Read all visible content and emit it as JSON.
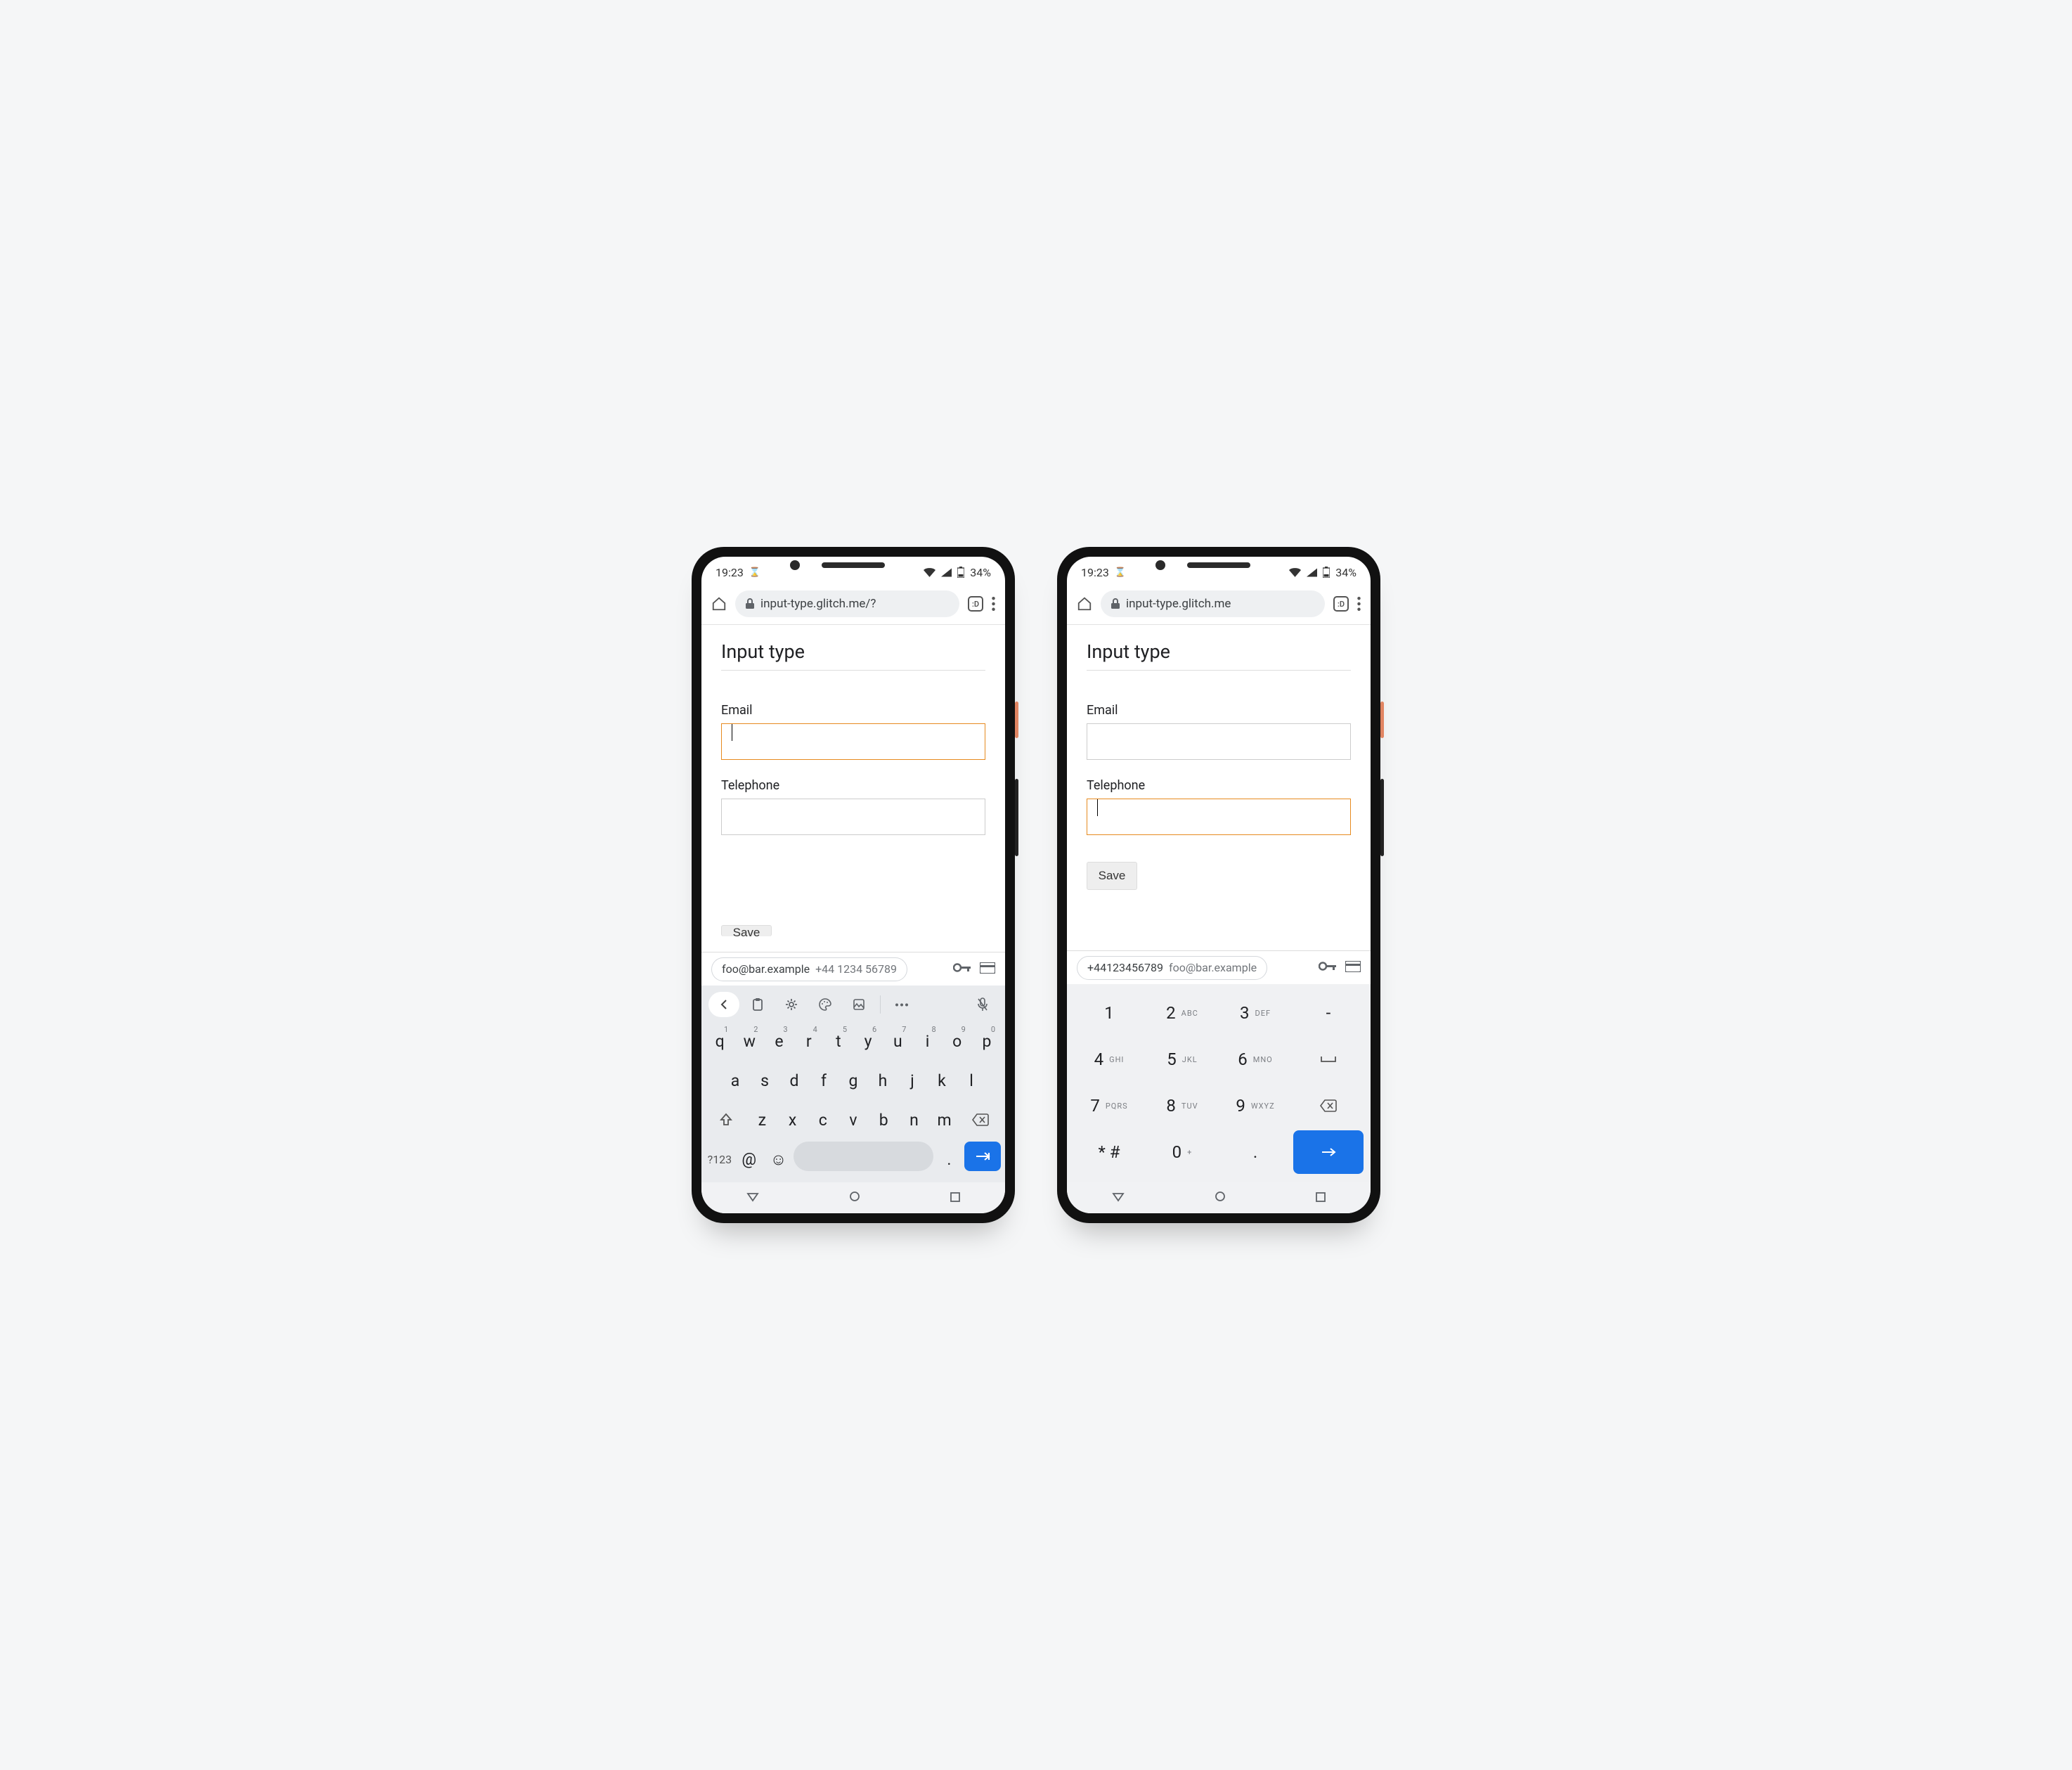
{
  "status": {
    "time": "19:23",
    "battery": "34%"
  },
  "browser": {
    "urlA": "input-type.glitch.me/?",
    "urlB": "input-type.glitch.me",
    "tabs": ":D"
  },
  "page": {
    "title": "Input type",
    "emailLabel": "Email",
    "telLabel": "Telephone",
    "saveLabel": "Save"
  },
  "autofill": {
    "email": "foo@bar.example",
    "phone": "+44 1234 56789",
    "phoneCompact": "+44123456789"
  },
  "qwerty": {
    "row1": [
      {
        "k": "q",
        "n": "1"
      },
      {
        "k": "w",
        "n": "2"
      },
      {
        "k": "e",
        "n": "3"
      },
      {
        "k": "r",
        "n": "4"
      },
      {
        "k": "t",
        "n": "5"
      },
      {
        "k": "y",
        "n": "6"
      },
      {
        "k": "u",
        "n": "7"
      },
      {
        "k": "i",
        "n": "8"
      },
      {
        "k": "o",
        "n": "9"
      },
      {
        "k": "p",
        "n": "0"
      }
    ],
    "row2": [
      "a",
      "s",
      "d",
      "f",
      "g",
      "h",
      "j",
      "k",
      "l"
    ],
    "row3": [
      "z",
      "x",
      "c",
      "v",
      "b",
      "n",
      "m"
    ],
    "symKey": "?123",
    "atKey": "@",
    "periodKey": "."
  },
  "numpad": {
    "rows": [
      [
        {
          "d": "1",
          "s": ""
        },
        {
          "d": "2",
          "s": "ABC"
        },
        {
          "d": "3",
          "s": "DEF"
        },
        {
          "d": "-",
          "s": ""
        }
      ],
      [
        {
          "d": "4",
          "s": "GHI"
        },
        {
          "d": "5",
          "s": "JKL"
        },
        {
          "d": "6",
          "s": "MNO"
        },
        {
          "d": "␣",
          "s": ""
        }
      ],
      [
        {
          "d": "7",
          "s": "PQRS"
        },
        {
          "d": "8",
          "s": "TUV"
        },
        {
          "d": "9",
          "s": "WXYZ"
        },
        {
          "d": "⌫",
          "s": ""
        }
      ],
      [
        {
          "d": "* #",
          "s": ""
        },
        {
          "d": "0",
          "s": "+"
        },
        {
          "d": ".",
          "s": ""
        },
        {
          "d": "→",
          "s": ""
        }
      ]
    ]
  }
}
